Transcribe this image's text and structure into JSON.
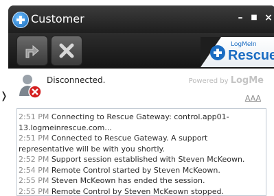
{
  "window": {
    "title": "Customer",
    "minimize_glyph": "–",
    "maximize_glyph": "■",
    "close_glyph": "×"
  },
  "toolbar": {
    "items": [
      {
        "name": "transfer-button",
        "icon": "share-arrow-icon"
      },
      {
        "name": "end-session-button",
        "icon": "close-x-icon"
      }
    ]
  },
  "brand": {
    "top": "LogMeIn",
    "main": "Rescue"
  },
  "status": {
    "text": "Disconnected.",
    "powered_by_prefix": "Powered by",
    "powered_by_brand": "LogMe",
    "font_size_control": "AAA"
  },
  "log": [
    {
      "time": "2:51 PM",
      "text": "Connecting to Rescue Gateway: control.app01-13.logmeinrescue.com..."
    },
    {
      "time": "2:51 PM",
      "text": "Connected to Rescue Gateway. A support representative will be with you shortly."
    },
    {
      "time": "2:52 PM",
      "text": "Support session established with Steven McKeown."
    },
    {
      "time": "2:54 PM",
      "text": "Remote Control started by Steven McKeown."
    },
    {
      "time": "2:55 PM",
      "text": "Steven McKeown has ended the session."
    },
    {
      "time": "2:55 PM",
      "text": "Remote Control by Steven McKeown stopped."
    }
  ]
}
